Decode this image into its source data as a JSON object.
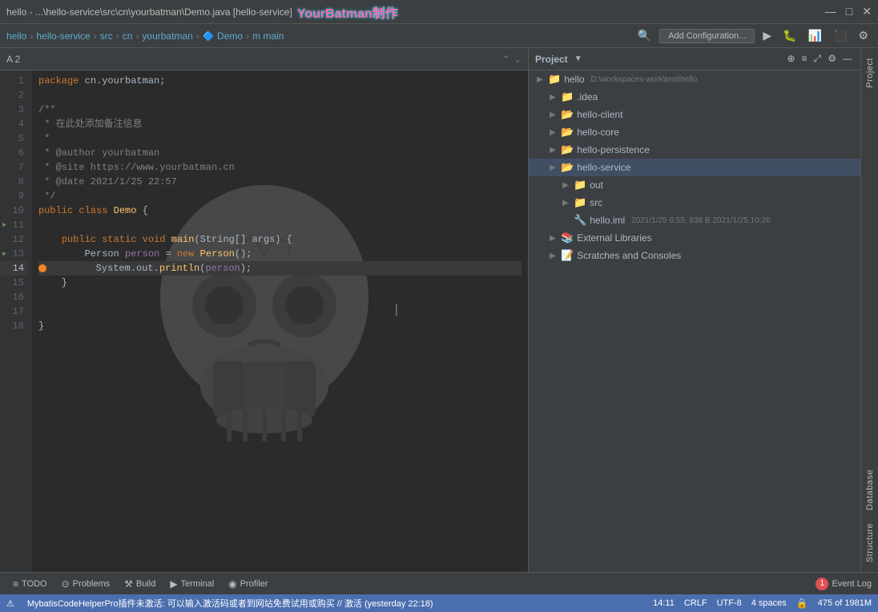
{
  "titleBar": {
    "title": "hello - ...\\hello-service\\src\\cn\\yourbatman\\Demo.java [hello-service]",
    "watermark": "YourBatman制作",
    "controls": [
      "—",
      "□",
      "✕"
    ]
  },
  "navBar": {
    "items": [
      "hello",
      "hello-service",
      "src",
      "cn",
      "yourbatman",
      "Demo",
      "main"
    ],
    "addConfigLabel": "Add Configuration...",
    "searchIcon": "🔍"
  },
  "editor": {
    "filename": "Demo.java",
    "lineCount": "A 2",
    "lines": [
      {
        "num": 1,
        "content": "package cn.yourbatman;"
      },
      {
        "num": 2,
        "content": ""
      },
      {
        "num": 3,
        "content": "/**"
      },
      {
        "num": 4,
        "content": " * 在此处添加备注信息"
      },
      {
        "num": 5,
        "content": " *"
      },
      {
        "num": 6,
        "content": " * @author yourbatman"
      },
      {
        "num": 7,
        "content": " * @site https://www.yourbatman.cn"
      },
      {
        "num": 8,
        "content": " * @date 2021/1/25 22:57"
      },
      {
        "num": 9,
        "content": " */"
      },
      {
        "num": 10,
        "content": "public class Demo {"
      },
      {
        "num": 11,
        "content": ""
      },
      {
        "num": 12,
        "content": "    public static void main(String[] args) {"
      },
      {
        "num": 13,
        "content": "        Person person = new Person();"
      },
      {
        "num": 14,
        "content": "        System.out.println(person);"
      },
      {
        "num": 15,
        "content": "    }"
      },
      {
        "num": 16,
        "content": ""
      },
      {
        "num": 17,
        "content": ""
      },
      {
        "num": 18,
        "content": "}"
      }
    ]
  },
  "projectPanel": {
    "title": "Project",
    "rootLabel": "hello",
    "rootPath": "D:\\workspaces-work\\test\\hello",
    "items": [
      {
        "label": ".idea",
        "type": "folder",
        "indent": 1,
        "arrow": "▶"
      },
      {
        "label": "hello-client",
        "type": "folder-blue",
        "indent": 1,
        "arrow": "▶"
      },
      {
        "label": "hello-core",
        "type": "folder-blue",
        "indent": 1,
        "arrow": "▶"
      },
      {
        "label": "hello-persistence",
        "type": "folder-blue",
        "indent": 1,
        "arrow": "▶"
      },
      {
        "label": "hello-service",
        "type": "folder-blue",
        "indent": 1,
        "arrow": "▶",
        "selected": true
      },
      {
        "label": "out",
        "type": "folder",
        "indent": 2,
        "arrow": "▶"
      },
      {
        "label": "src",
        "type": "folder",
        "indent": 2,
        "arrow": "▶"
      },
      {
        "label": "hello.iml",
        "type": "iml",
        "indent": 2,
        "arrow": "",
        "meta": "2021/1/25 6:55, 838 B 2021/1/25 10:26"
      }
    ],
    "externalLibraries": {
      "label": "External Libraries",
      "arrow": "▶"
    },
    "scratches": {
      "label": "Scratches and Consoles",
      "arrow": "▶"
    }
  },
  "verticalTabs": {
    "tabs": [
      "Project",
      "Database",
      "Structure"
    ]
  },
  "bottomBar": {
    "tabs": [
      {
        "icon": "≡",
        "label": "TODO"
      },
      {
        "icon": "⊙",
        "label": "Problems"
      },
      {
        "icon": "⚒",
        "label": "Build"
      },
      {
        "icon": "▶",
        "label": "Terminal"
      },
      {
        "icon": "◉",
        "label": "Profiler"
      }
    ],
    "eventLog": {
      "count": "1",
      "label": "Event Log"
    }
  },
  "statusBar": {
    "warning": "MybatisCodeHelperPro插件未激活: 可以输入激活码或者到网站免费试用或购买 // 激活 (yesterday 22:18)",
    "position": "14:11",
    "lineEnding": "CRLF",
    "encoding": "UTF-8",
    "indent": "4 spaces",
    "pageInfo": "475 of 1981M"
  }
}
